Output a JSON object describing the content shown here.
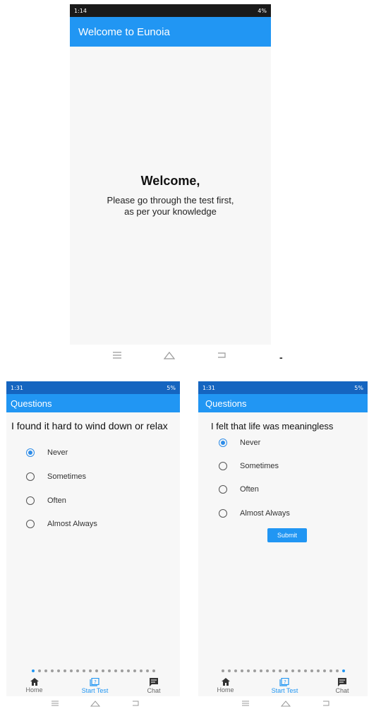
{
  "colors": {
    "accent": "#2196f3",
    "statusbar": "#1565c0",
    "page": "#f7f7f7"
  },
  "screen1": {
    "status_time": "1:14",
    "status_right": "4%",
    "appbar_title": "Welcome to Eunoia",
    "welcome_heading": "Welcome,",
    "welcome_line1": "Please go through the test first,",
    "welcome_line2": "as per your knowledge"
  },
  "separator": "-",
  "screen2": {
    "status_time": "1:31",
    "status_right": "5%",
    "appbar_title": "Questions",
    "question": "I found it hard to wind down or relax",
    "options": [
      "Never",
      "Sometimes",
      "Often",
      "Almost Always"
    ],
    "selected_index": 0,
    "page_dots": 20,
    "active_dot": 0,
    "tabs": [
      {
        "label": "Home",
        "icon": "home-icon"
      },
      {
        "label": "Start Test",
        "icon": "quiz-icon"
      },
      {
        "label": "Chat",
        "icon": "chat-icon"
      }
    ],
    "active_tab": 1
  },
  "screen3": {
    "status_time": "1:31",
    "status_right": "5%",
    "appbar_title": "Questions",
    "question": "I felt that life was meaningless",
    "options": [
      "Never",
      "Sometimes",
      "Often",
      "Almost Always"
    ],
    "selected_index": 0,
    "submit_label": "Submit",
    "page_dots": 20,
    "active_dot": 19,
    "tabs": [
      {
        "label": "Home",
        "icon": "home-icon"
      },
      {
        "label": "Start Test",
        "icon": "quiz-icon"
      },
      {
        "label": "Chat",
        "icon": "chat-icon"
      }
    ],
    "active_tab": 1
  }
}
